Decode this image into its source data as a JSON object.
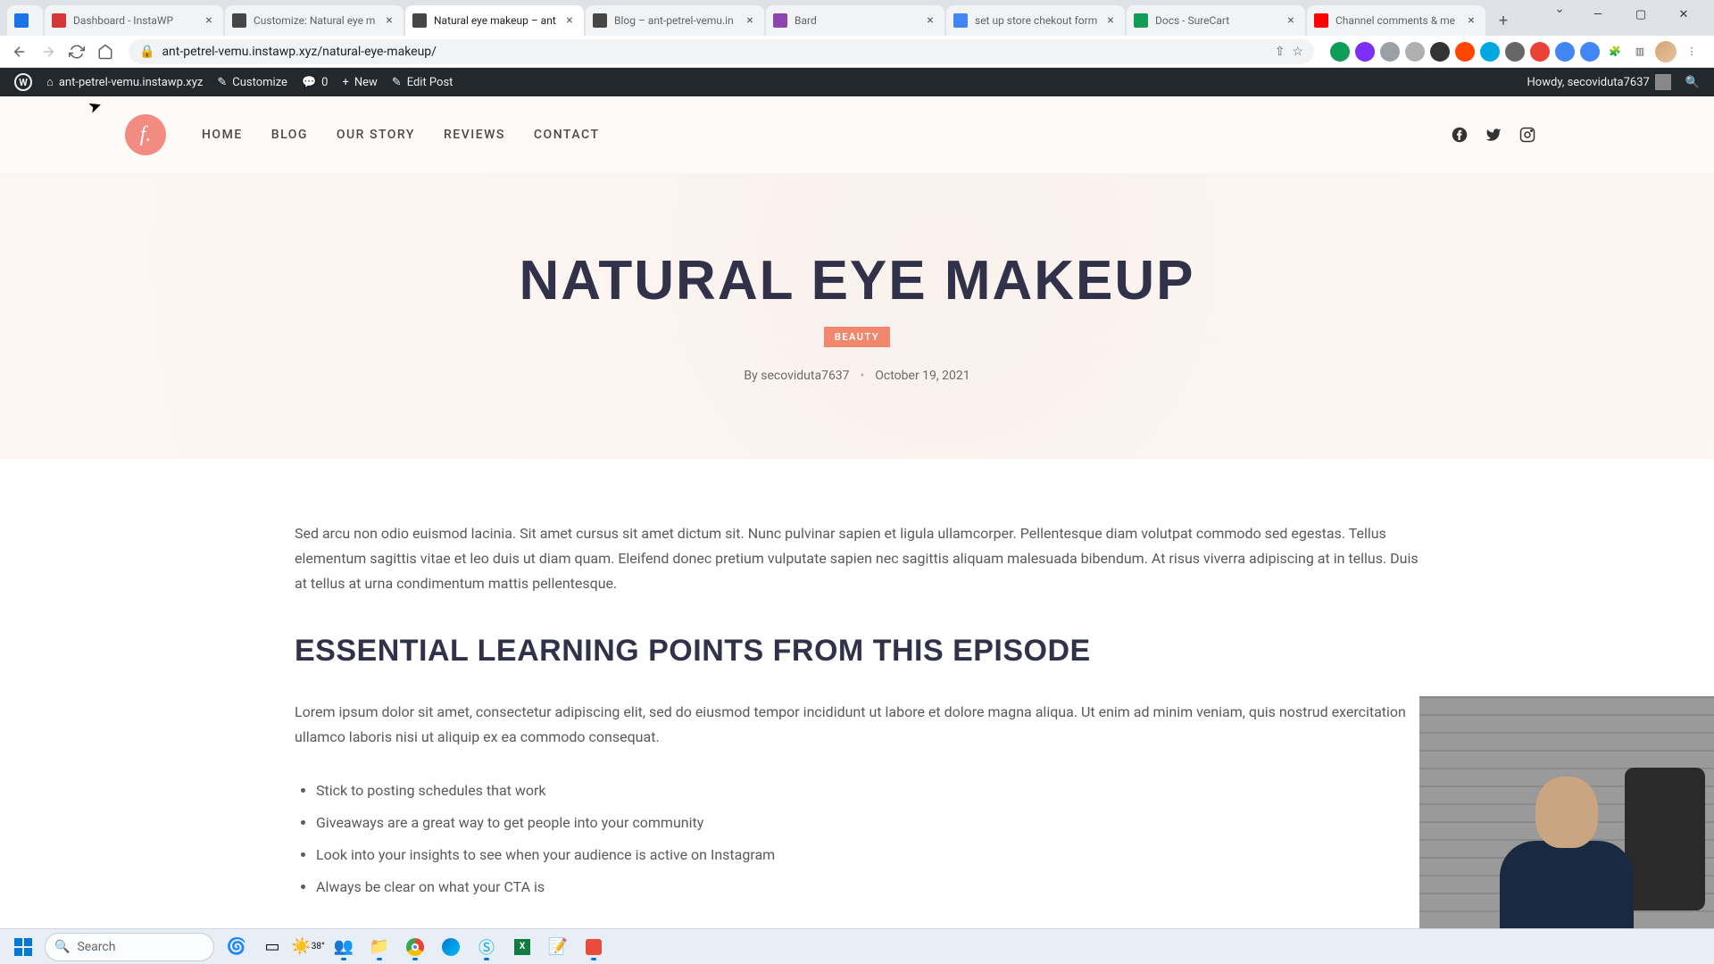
{
  "browser": {
    "tabs": [
      {
        "title": "",
        "favicon": "#1a73e8"
      },
      {
        "title": "Dashboard - InstaWP",
        "favicon": "#d63638"
      },
      {
        "title": "Customize: Natural eye m",
        "favicon": "#464646"
      },
      {
        "title": "Natural eye makeup – ant",
        "favicon": "#464646",
        "active": true
      },
      {
        "title": "Blog – ant-petrel-vemu.in",
        "favicon": "#464646"
      },
      {
        "title": "Bard",
        "favicon": "#8e44ad"
      },
      {
        "title": "set up store chekout form",
        "favicon": "#4285f4"
      },
      {
        "title": "Docs - SureCart",
        "favicon": "#0f9d58"
      },
      {
        "title": "Channel comments & me",
        "favicon": "#ff0000"
      }
    ],
    "url": "ant-petrel-vemu.instawp.xyz/natural-eye-makeup/",
    "extensions": [
      "#0f9d58",
      "#7b2ff7",
      "#9aa0a6",
      "#b0b0b0",
      "#333",
      "#ff4500",
      "#00a8e1",
      "#666",
      "#ea4335",
      "#4285f4",
      "#4285f4",
      "#555"
    ]
  },
  "wp_bar": {
    "site_name": "ant-petrel-vemu.instawp.xyz",
    "customize": "Customize",
    "comments": "0",
    "new": "New",
    "edit": "Edit Post",
    "howdy": "Howdy, secoviduta7637"
  },
  "nav": {
    "items": [
      "HOME",
      "BLOG",
      "OUR STORY",
      "REVIEWS",
      "CONTACT"
    ]
  },
  "hero": {
    "title": "NATURAL EYE MAKEUP",
    "badge": "BEAUTY",
    "author_prefix": "By",
    "author": "secoviduta7637",
    "date": "October 19, 2021"
  },
  "content": {
    "p1": "Sed arcu non odio euismod lacinia. Sit amet cursus sit amet dictum sit. Nunc pulvinar sapien et ligula ullamcorper. Pellentesque diam volutpat commodo sed egestas. Tellus elementum sagittis vitae et leo duis ut diam quam. Eleifend donec pretium vulputate sapien nec sagittis aliquam malesuada bibendum. At risus viverra adipiscing at in tellus. Duis at tellus at urna condimentum mattis pellentesque.",
    "h2": "ESSENTIAL LEARNING POINTS FROM THIS EPISODE",
    "p2": "Lorem ipsum dolor sit amet, consectetur adipiscing elit, sed do eiusmod tempor incididunt ut labore et dolore magna aliqua. Ut enim ad minim veniam, quis nostrud exercitation ullamco laboris nisi ut aliquip ex ea commodo consequat.",
    "bullets": [
      "Stick to posting schedules that work",
      "Giveaways are a great way to get people into your community",
      "Look into your insights to see when your audience is active on Instagram",
      "Always be clear on what your CTA is"
    ]
  },
  "taskbar": {
    "search_placeholder": "Search",
    "temp": "38°"
  }
}
